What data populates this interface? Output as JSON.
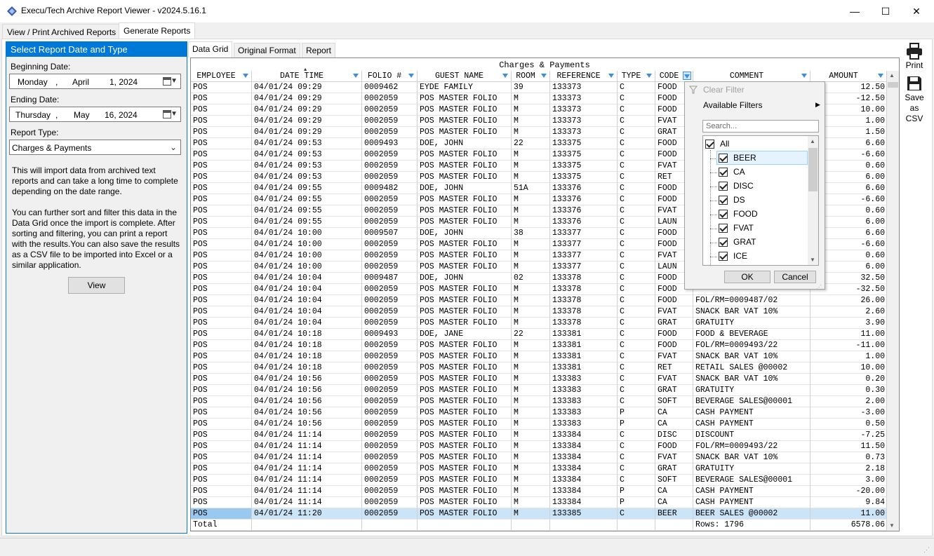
{
  "window": {
    "title": "Execu/Tech Archive Report Viewer - v2024.5.16.1",
    "minimize": "—",
    "maximize": "☐",
    "close": "✕"
  },
  "top_tabs": [
    "View / Print Archived Reports",
    "Generate Reports"
  ],
  "left": {
    "header": "Select Report Date and Type",
    "begin_label": "Beginning Date:",
    "begin": {
      "weekday": "Monday",
      "comma1": ",",
      "month": "April",
      "day": "1, 2024"
    },
    "end_label": "Ending Date:",
    "end": {
      "weekday": "Thursday",
      "comma1": ",",
      "month": "May",
      "day": "16, 2024"
    },
    "type_label": "Report Type:",
    "type_value": "Charges & Payments",
    "desc1": "This will import data from archived text reports and can take a long time to complete depending on the date range.",
    "desc2": "You can further sort and filter this data in the Data Grid once the import is complete. After sorting and filtering, you can print a report with the results.You can also save the results as a CSV file to be imported into Excel or a similar application.",
    "view_button": "View"
  },
  "inner_tabs": [
    "Data Grid",
    "Original Format",
    "Report"
  ],
  "grid": {
    "title": "Charges & Payments",
    "columns": [
      "EMPLOYEE",
      "DATE TIME",
      "FOLIO #",
      "GUEST NAME",
      "ROOM",
      "REFERENCE",
      "TYPE",
      "CODE",
      "COMMENT",
      "AMOUNT"
    ],
    "rows": [
      [
        "POS",
        "04/01/24 09:29",
        "0009462",
        "EYDE FAMILY",
        "39",
        "133373",
        "C",
        "FOOD",
        "",
        "12.50"
      ],
      [
        "POS",
        "04/01/24 09:29",
        "0002059",
        "POS MASTER FOLIO",
        "M",
        "133373",
        "C",
        "FOOD",
        "",
        "-12.50"
      ],
      [
        "POS",
        "04/01/24 09:29",
        "0002059",
        "POS MASTER FOLIO",
        "M",
        "133373",
        "C",
        "FOOD",
        "",
        "10.00"
      ],
      [
        "POS",
        "04/01/24 09:29",
        "0002059",
        "POS MASTER FOLIO",
        "M",
        "133373",
        "C",
        "FVAT",
        "",
        "1.00"
      ],
      [
        "POS",
        "04/01/24 09:29",
        "0002059",
        "POS MASTER FOLIO",
        "M",
        "133373",
        "C",
        "GRAT",
        "",
        "1.50"
      ],
      [
        "POS",
        "04/01/24 09:53",
        "0009493",
        "DOE, JOHN",
        "22",
        "133375",
        "C",
        "FOOD",
        "",
        "6.60"
      ],
      [
        "POS",
        "04/01/24 09:53",
        "0002059",
        "POS MASTER FOLIO",
        "M",
        "133375",
        "C",
        "FOOD",
        "",
        "-6.60"
      ],
      [
        "POS",
        "04/01/24 09:53",
        "0002059",
        "POS MASTER FOLIO",
        "M",
        "133375",
        "C",
        "FVAT",
        "",
        "0.60"
      ],
      [
        "POS",
        "04/01/24 09:53",
        "0002059",
        "POS MASTER FOLIO",
        "M",
        "133375",
        "C",
        "RET",
        "",
        "6.00"
      ],
      [
        "POS",
        "04/01/24 09:55",
        "0009482",
        "DOE, JOHN",
        "51A",
        "133376",
        "C",
        "FOOD",
        "",
        "6.60"
      ],
      [
        "POS",
        "04/01/24 09:55",
        "0002059",
        "POS MASTER FOLIO",
        "M",
        "133376",
        "C",
        "FOOD",
        "",
        "-6.60"
      ],
      [
        "POS",
        "04/01/24 09:55",
        "0002059",
        "POS MASTER FOLIO",
        "M",
        "133376",
        "C",
        "FVAT",
        "",
        "0.60"
      ],
      [
        "POS",
        "04/01/24 09:55",
        "0002059",
        "POS MASTER FOLIO",
        "M",
        "133376",
        "C",
        "LAUN",
        "",
        "6.00"
      ],
      [
        "POS",
        "04/01/24 10:00",
        "0009507",
        "DOE, JOHN",
        "38",
        "133377",
        "C",
        "FOOD",
        "",
        "6.60"
      ],
      [
        "POS",
        "04/01/24 10:00",
        "0002059",
        "POS MASTER FOLIO",
        "M",
        "133377",
        "C",
        "FOOD",
        "",
        "-6.60"
      ],
      [
        "POS",
        "04/01/24 10:00",
        "0002059",
        "POS MASTER FOLIO",
        "M",
        "133377",
        "C",
        "FVAT",
        "",
        "0.60"
      ],
      [
        "POS",
        "04/01/24 10:00",
        "0002059",
        "POS MASTER FOLIO",
        "M",
        "133377",
        "C",
        "LAUN",
        "",
        "6.00"
      ],
      [
        "POS",
        "04/01/24 10:04",
        "0009487",
        "DOE, JOHN",
        "02",
        "133378",
        "C",
        "FOOD",
        "",
        "32.50"
      ],
      [
        "POS",
        "04/01/24 10:04",
        "0002059",
        "POS MASTER FOLIO",
        "M",
        "133378",
        "C",
        "FOOD",
        "",
        "-32.50"
      ],
      [
        "POS",
        "04/01/24 10:04",
        "0002059",
        "POS MASTER FOLIO",
        "M",
        "133378",
        "C",
        "FOOD",
        "FOL/RM=0009487/02",
        "26.00"
      ],
      [
        "POS",
        "04/01/24 10:04",
        "0002059",
        "POS MASTER FOLIO",
        "M",
        "133378",
        "C",
        "FVAT",
        "SNACK BAR VAT 10%",
        "2.60"
      ],
      [
        "POS",
        "04/01/24 10:04",
        "0002059",
        "POS MASTER FOLIO",
        "M",
        "133378",
        "C",
        "GRAT",
        "GRATUITY",
        "3.90"
      ],
      [
        "POS",
        "04/01/24 10:18",
        "0009493",
        "DOE, JANE",
        "22",
        "133381",
        "C",
        "FOOD",
        "FOOD & BEVERAGE",
        "11.00"
      ],
      [
        "POS",
        "04/01/24 10:18",
        "0002059",
        "POS MASTER FOLIO",
        "M",
        "133381",
        "C",
        "FOOD",
        "FOL/RM=0009493/22",
        "-11.00"
      ],
      [
        "POS",
        "04/01/24 10:18",
        "0002059",
        "POS MASTER FOLIO",
        "M",
        "133381",
        "C",
        "FVAT",
        "SNACK BAR VAT 10%",
        "1.00"
      ],
      [
        "POS",
        "04/01/24 10:18",
        "0002059",
        "POS MASTER FOLIO",
        "M",
        "133381",
        "C",
        "RET",
        "RETAIL SALES  @00002",
        "10.00"
      ],
      [
        "POS",
        "04/01/24 10:56",
        "0002059",
        "POS MASTER FOLIO",
        "M",
        "133383",
        "C",
        "FVAT",
        "SNACK BAR VAT 10%",
        "0.20"
      ],
      [
        "POS",
        "04/01/24 10:56",
        "0002059",
        "POS MASTER FOLIO",
        "M",
        "133383",
        "C",
        "GRAT",
        "GRATUITY",
        "0.30"
      ],
      [
        "POS",
        "04/01/24 10:56",
        "0002059",
        "POS MASTER FOLIO",
        "M",
        "133383",
        "C",
        "SOFT",
        "BEVERAGE SALES@00001",
        "2.00"
      ],
      [
        "POS",
        "04/01/24 10:56",
        "0002059",
        "POS MASTER FOLIO",
        "M",
        "133383",
        "P",
        "CA",
        "CASH PAYMENT",
        "-3.00"
      ],
      [
        "POS",
        "04/01/24 10:56",
        "0002059",
        "POS MASTER FOLIO",
        "M",
        "133383",
        "P",
        "CA",
        "CASH PAYMENT",
        "0.50"
      ],
      [
        "POS",
        "04/01/24 11:14",
        "0002059",
        "POS MASTER FOLIO",
        "M",
        "133384",
        "C",
        "DISC",
        "DISCOUNT",
        "-7.25"
      ],
      [
        "POS",
        "04/01/24 11:14",
        "0002059",
        "POS MASTER FOLIO",
        "M",
        "133384",
        "C",
        "FOOD",
        "FOL/RM=0009493/22",
        "11.50"
      ],
      [
        "POS",
        "04/01/24 11:14",
        "0002059",
        "POS MASTER FOLIO",
        "M",
        "133384",
        "C",
        "FVAT",
        "SNACK BAR VAT 10%",
        "0.73"
      ],
      [
        "POS",
        "04/01/24 11:14",
        "0002059",
        "POS MASTER FOLIO",
        "M",
        "133384",
        "C",
        "GRAT",
        "GRATUITY",
        "2.18"
      ],
      [
        "POS",
        "04/01/24 11:14",
        "0002059",
        "POS MASTER FOLIO",
        "M",
        "133384",
        "C",
        "SOFT",
        "BEVERAGE SALES@00001",
        "3.00"
      ],
      [
        "POS",
        "04/01/24 11:14",
        "0002059",
        "POS MASTER FOLIO",
        "M",
        "133384",
        "P",
        "CA",
        "CASH PAYMENT",
        "-20.00"
      ],
      [
        "POS",
        "04/01/24 11:14",
        "0002059",
        "POS MASTER FOLIO",
        "M",
        "133384",
        "P",
        "CA",
        "CASH PAYMENT",
        "9.84"
      ],
      [
        "POS",
        "04/01/24 11:20",
        "0002059",
        "POS MASTER FOLIO",
        "M",
        "133385",
        "C",
        "BEER",
        "BEER SALES    @00002",
        "11.00"
      ]
    ],
    "total": {
      "label": "Total",
      "rows": "Rows: 1796",
      "amount": "6578.06"
    }
  },
  "filter_popup": {
    "clear": "Clear Filter",
    "available": "Available Filters",
    "search_placeholder": "Search...",
    "items": [
      "All",
      "BEER",
      "CA",
      "DISC",
      "DS",
      "FOOD",
      "FVAT",
      "GRAT",
      "ICE"
    ],
    "ok": "OK",
    "cancel": "Cancel"
  },
  "toolbar": {
    "print": "Print",
    "save_csv_1": "Save",
    "save_csv_2": "as",
    "save_csv_3": "CSV"
  },
  "colors": {
    "accent": "#0078d7",
    "filter_icon": "#3d8ee0",
    "selected_row": "#cce4f7"
  }
}
